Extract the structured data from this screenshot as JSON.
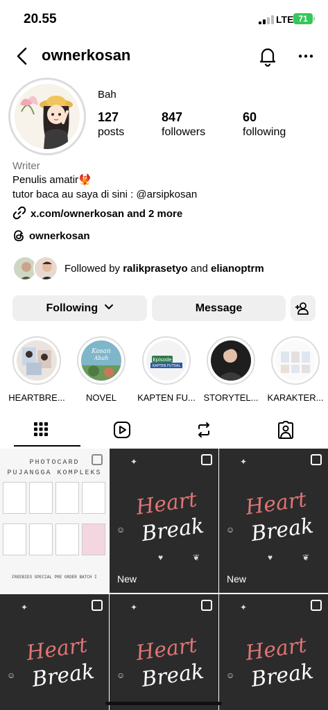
{
  "status": {
    "time": "20.55",
    "network": "LTE",
    "battery": "71"
  },
  "header": {
    "username": "ownerkosan"
  },
  "profile": {
    "display_name": "Bah",
    "stats": [
      {
        "value": "127",
        "label": "posts"
      },
      {
        "value": "847",
        "label": "followers"
      },
      {
        "value": "60",
        "label": "following"
      }
    ],
    "category": "Writer",
    "bio_line1": "Penulis amatir🐦‍🔥",
    "bio_line2": "tutor baca au saya di sini : @arsipkosan",
    "link": "x.com/ownerkosan and 2 more",
    "threads": "ownerkosan",
    "followed_by_prefix": "Followed by",
    "followed_by_user1": "ralikprasetyo",
    "followed_by_and": "and",
    "followed_by_user2": "elianoptrm"
  },
  "actions": {
    "following": "Following",
    "message": "Message"
  },
  "highlights": [
    {
      "label": "HEARTBRE..."
    },
    {
      "label": "NOVEL"
    },
    {
      "label": "KAPTEN FU..."
    },
    {
      "label": "STORYTEL..."
    },
    {
      "label": "KARAKTER..."
    }
  ],
  "grid": {
    "pc_title1": "PHOTOCARD",
    "pc_title2": "PUJANGGA KOMPLEKS",
    "pc_footer": "FREEBIES SPECIAL PRE ORDER BATCH I",
    "post_word1": "Heart",
    "post_word2": "Break",
    "new_label": "New"
  },
  "colors": {
    "button_bg": "#efefef",
    "battery": "#34c759",
    "secondary_text": "#737373",
    "accent_heart": "#e07474"
  }
}
